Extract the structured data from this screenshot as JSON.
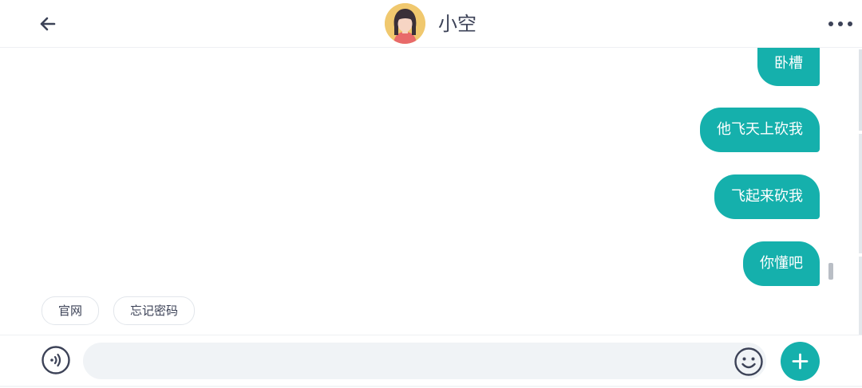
{
  "header": {
    "contact_name": "小空",
    "back_icon": "arrow-left-icon",
    "more_icon": "more-horizontal-icon",
    "avatar": "cartoon-girl-avatar"
  },
  "messages": [
    {
      "sender": "me",
      "text": "卧槽"
    },
    {
      "sender": "me",
      "text": "他飞天上砍我"
    },
    {
      "sender": "me",
      "text": "飞起来砍我"
    },
    {
      "sender": "me",
      "text": "你懂吧"
    }
  ],
  "quick_replies": [
    "官网",
    "忘记密码"
  ],
  "composer": {
    "value": "",
    "voice_icon": "voice-icon",
    "emoji_icon": "smiley-icon",
    "add_icon": "plus-icon"
  },
  "colors": {
    "accent": "#15b0ac",
    "text": "#3c4257",
    "input_bg": "#f0f3f6"
  }
}
